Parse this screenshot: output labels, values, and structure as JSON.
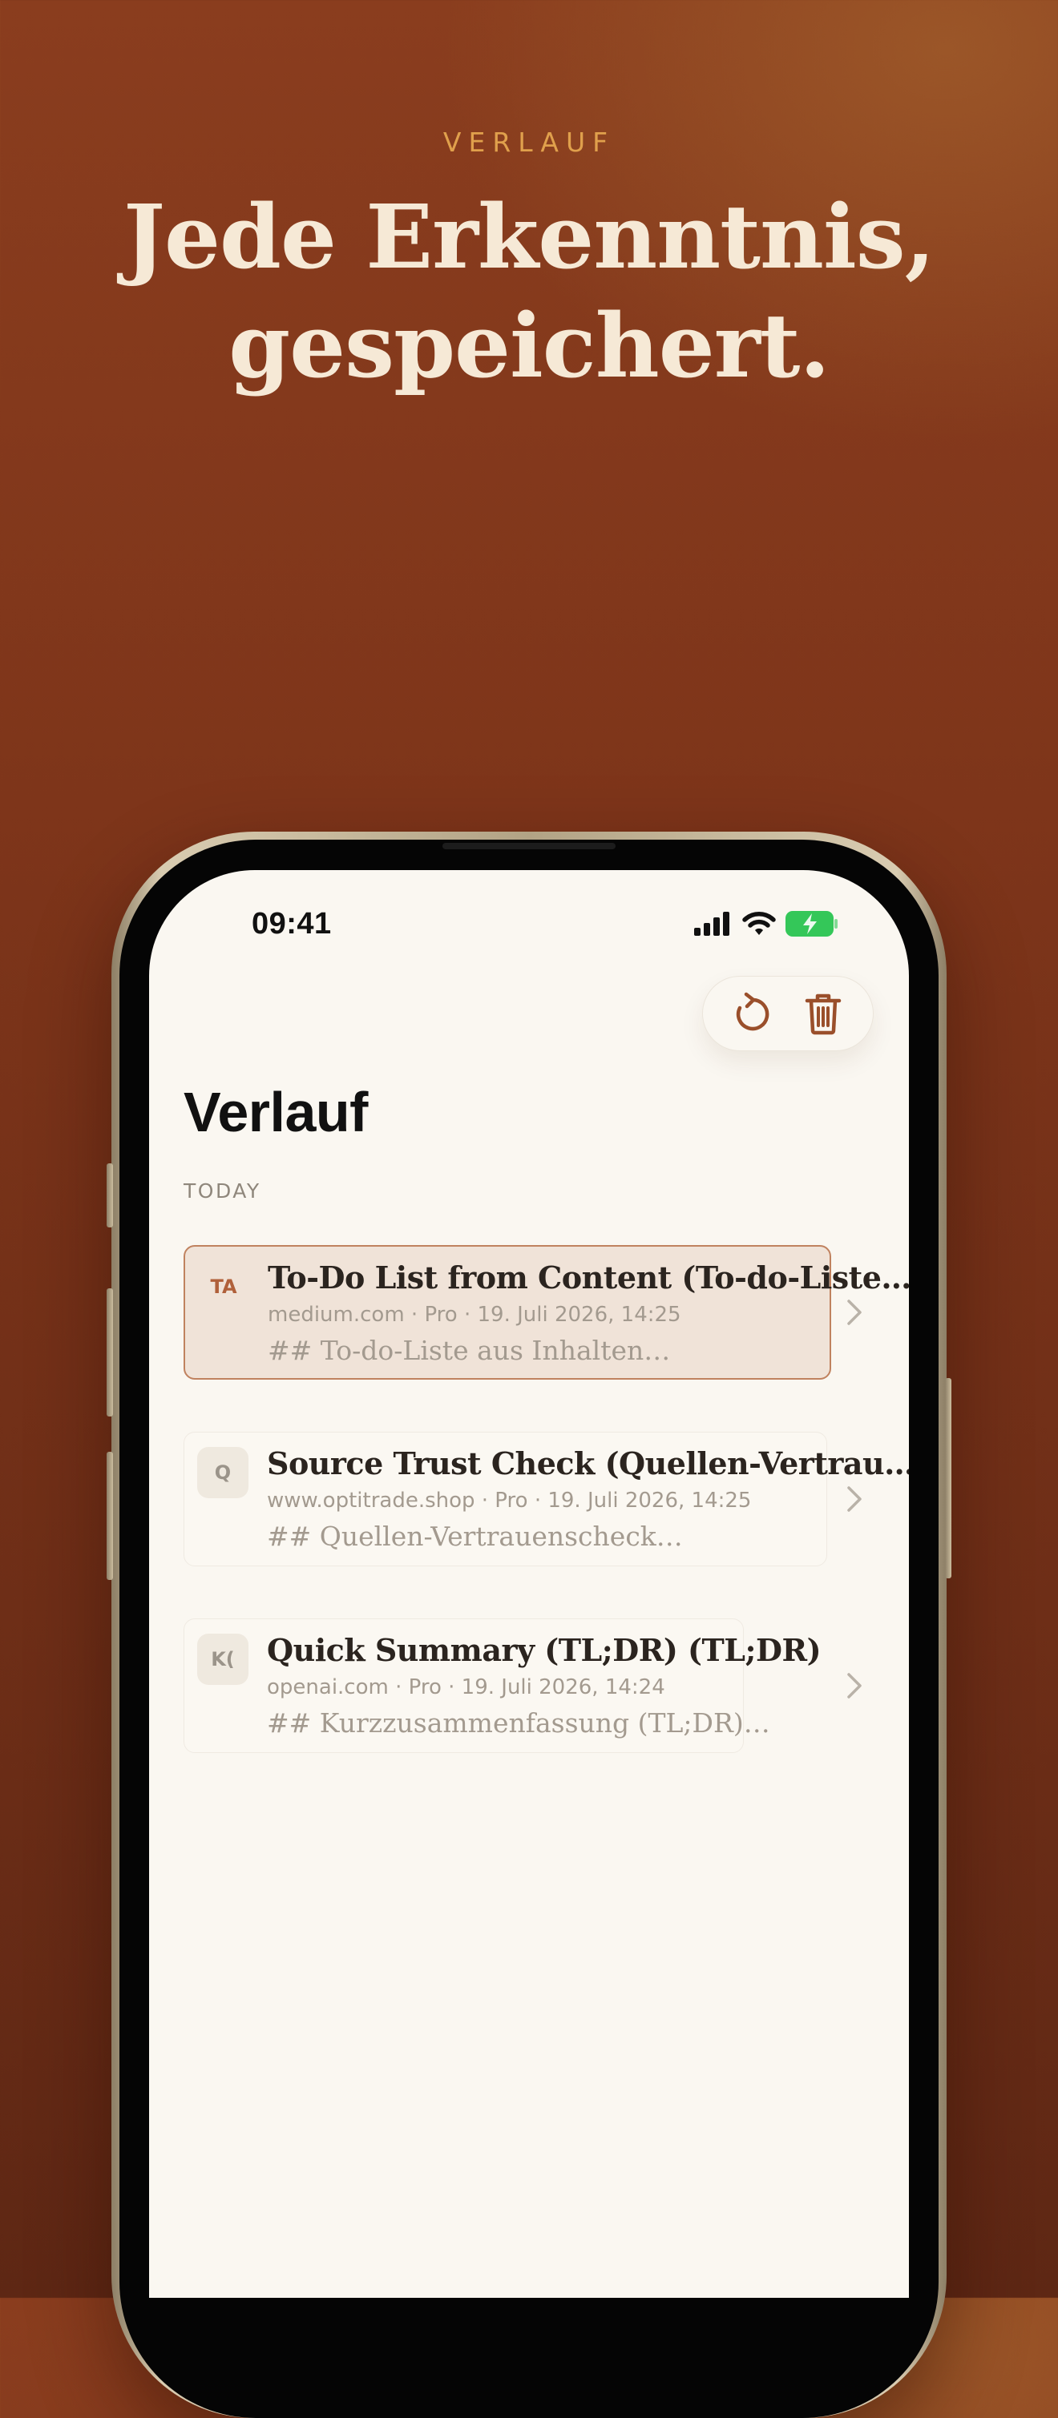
{
  "promo": {
    "eyebrow": "VERLAUF",
    "headline_line1": "Jede Erkenntnis,",
    "headline_line2": "gespeichert."
  },
  "status_bar": {
    "time": "09:41",
    "icons": [
      "signal-icon",
      "wifi-icon",
      "battery-charging-icon"
    ]
  },
  "toolbar": {
    "icons": [
      "refresh-icon",
      "trash-icon"
    ],
    "accent_color": "#9a4f2b"
  },
  "page": {
    "title": "Verlauf",
    "section_label": "TODAY"
  },
  "history": [
    {
      "initials": "TA",
      "title": "To-Do List from Content (To-do-Liste…",
      "meta": "medium.com · Pro · 19. Juli 2026, 14:25",
      "preview": "## To-do-Liste aus Inhalten…",
      "selected": true
    },
    {
      "initials": "Q",
      "title": "Source Trust Check (Quellen-Vertrau…",
      "meta": "www.optitrade.shop · Pro · 19. Juli 2026, 14:25",
      "preview": "## Quellen-Vertrauenscheck…",
      "selected": false
    },
    {
      "initials": "K(",
      "title": "Quick Summary (TL;DR) (TL;DR)",
      "meta": "openai.com · Pro · 19. Juli 2026, 14:24",
      "preview": "## Kurzzusammenfassung (TL;DR)…",
      "selected": false
    }
  ],
  "colors": {
    "background": "#7e351a",
    "eyebrow": "#e0a04c",
    "headline": "#f6e9d6",
    "screen": "#faf7f1",
    "selected_card": "#f0e3d8",
    "selected_border": "#c0825f",
    "battery_green": "#34c759"
  }
}
